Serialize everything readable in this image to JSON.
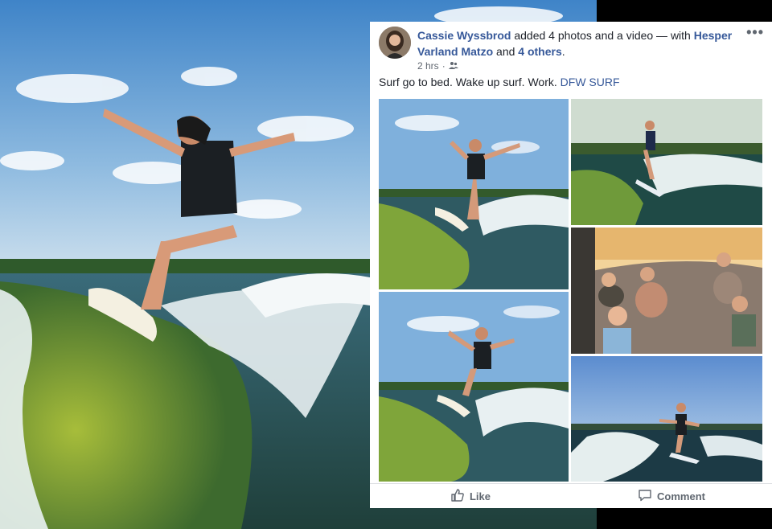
{
  "post": {
    "author": "Cassie Wyssbrod",
    "action_text": " added 4 photos and a video — with ",
    "tagged_name": "Hesper Varland Matzo",
    "and_text": " and ",
    "others": "4 others",
    "period": ".",
    "time": "2 hrs",
    "separator": "·",
    "privacy_icon": "friends-icon",
    "more_label": "•••",
    "text": "Surf go to bed. Wake up surf. Work. ",
    "text_tag": "DFW SURF"
  },
  "actions": {
    "like_label": "Like",
    "comment_label": "Comment"
  },
  "colors": {
    "link": "#365899",
    "text": "#1d2129",
    "muted": "#606770",
    "sky": "#4f8fd0",
    "water": "#2e5b4f",
    "wake": "#7d9a2f"
  }
}
